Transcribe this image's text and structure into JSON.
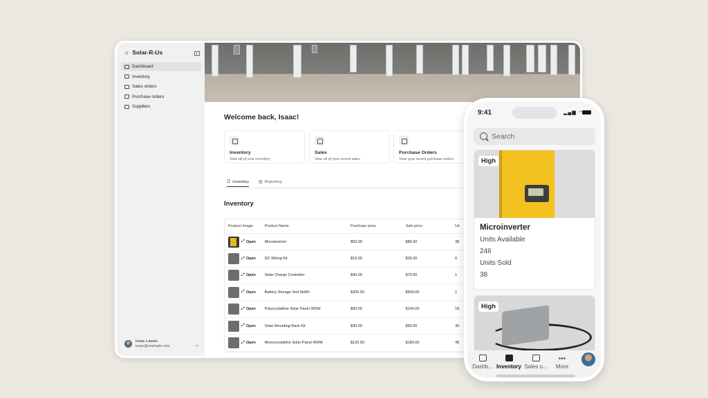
{
  "app": {
    "name": "Solar-R-Us"
  },
  "sidebar": {
    "items": [
      {
        "label": "Dashboard",
        "icon": "home-icon",
        "active": true
      },
      {
        "label": "Inventory",
        "icon": "box-icon"
      },
      {
        "label": "Sales orders",
        "icon": "file-icon"
      },
      {
        "label": "Purchase orders",
        "icon": "cart-icon"
      },
      {
        "label": "Suppliers",
        "icon": "truck-icon"
      }
    ],
    "user": {
      "name": "Isaac Lawan",
      "email": "isaac@example.com"
    }
  },
  "main": {
    "welcome": "Welcome back, Isaac!",
    "cards": [
      {
        "title": "Inventory",
        "subtitle": "View all of your inventory",
        "icon": "list-icon"
      },
      {
        "title": "Sales",
        "subtitle": "View all of your recent sales",
        "icon": "receipt-icon"
      },
      {
        "title": "Purchase Orders",
        "subtitle": "View your recent purchase orders",
        "icon": "money-icon"
      }
    ],
    "tabs": [
      {
        "label": "Inventory",
        "active": true
      },
      {
        "label": "Reporting"
      }
    ],
    "inventory_title": "Inventory",
    "table": {
      "headers": [
        "Product Image",
        "Product Name",
        "Purchase price",
        "Sale price",
        "Un"
      ],
      "open_label": "Open",
      "rows": [
        {
          "name": "Microinverter",
          "purchase": "$50.00",
          "sale": "$85.00",
          "units": "38"
        },
        {
          "name": "DC Wiring Kit",
          "purchase": "$15.00",
          "sale": "$25.00",
          "units": "6"
        },
        {
          "name": "Solar Charge Controller",
          "purchase": "$40.00",
          "sale": "$70.00",
          "units": "1"
        },
        {
          "name": "Battery Storage Unit 5kWh",
          "purchase": "$300.00",
          "sale": "$500.00",
          "units": "1"
        },
        {
          "name": "Polycrystalline Solar Panel 300W",
          "purchase": "$90.00",
          "sale": "$140.00",
          "units": "18"
        },
        {
          "name": "Solar Mounting Rack Kit",
          "purchase": "$30.00",
          "sale": "$55.00",
          "units": "30"
        },
        {
          "name": "Monocrystalline Solar Panel 400W",
          "purchase": "$120.00",
          "sale": "$180.00",
          "units": "45"
        }
      ]
    }
  },
  "phone": {
    "time": "9:41",
    "search_placeholder": "Search",
    "cards": [
      {
        "badge": "High",
        "name": "Microinverter",
        "units_available_label": "Units Available",
        "units_available": "246",
        "units_sold_label": "Units Sold",
        "units_sold": "38"
      },
      {
        "badge": "High"
      }
    ],
    "tabs": [
      {
        "label": "Dashb...",
        "icon": "home-icon"
      },
      {
        "label": "Inventory",
        "icon": "box-icon",
        "active": true
      },
      {
        "label": "Sales o...",
        "icon": "file-icon"
      },
      {
        "label": "More",
        "icon": "more-icon"
      }
    ]
  }
}
